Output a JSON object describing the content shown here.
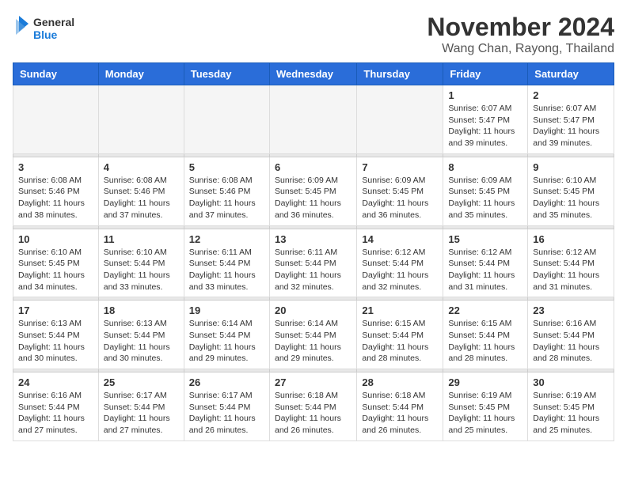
{
  "header": {
    "logo_general": "General",
    "logo_blue": "Blue",
    "month_title": "November 2024",
    "location": "Wang Chan, Rayong, Thailand"
  },
  "days_of_week": [
    "Sunday",
    "Monday",
    "Tuesday",
    "Wednesday",
    "Thursday",
    "Friday",
    "Saturday"
  ],
  "weeks": [
    [
      {
        "day": "",
        "info": ""
      },
      {
        "day": "",
        "info": ""
      },
      {
        "day": "",
        "info": ""
      },
      {
        "day": "",
        "info": ""
      },
      {
        "day": "",
        "info": ""
      },
      {
        "day": "1",
        "info": "Sunrise: 6:07 AM\nSunset: 5:47 PM\nDaylight: 11 hours and 39 minutes."
      },
      {
        "day": "2",
        "info": "Sunrise: 6:07 AM\nSunset: 5:47 PM\nDaylight: 11 hours and 39 minutes."
      }
    ],
    [
      {
        "day": "3",
        "info": "Sunrise: 6:08 AM\nSunset: 5:46 PM\nDaylight: 11 hours and 38 minutes."
      },
      {
        "day": "4",
        "info": "Sunrise: 6:08 AM\nSunset: 5:46 PM\nDaylight: 11 hours and 37 minutes."
      },
      {
        "day": "5",
        "info": "Sunrise: 6:08 AM\nSunset: 5:46 PM\nDaylight: 11 hours and 37 minutes."
      },
      {
        "day": "6",
        "info": "Sunrise: 6:09 AM\nSunset: 5:45 PM\nDaylight: 11 hours and 36 minutes."
      },
      {
        "day": "7",
        "info": "Sunrise: 6:09 AM\nSunset: 5:45 PM\nDaylight: 11 hours and 36 minutes."
      },
      {
        "day": "8",
        "info": "Sunrise: 6:09 AM\nSunset: 5:45 PM\nDaylight: 11 hours and 35 minutes."
      },
      {
        "day": "9",
        "info": "Sunrise: 6:10 AM\nSunset: 5:45 PM\nDaylight: 11 hours and 35 minutes."
      }
    ],
    [
      {
        "day": "10",
        "info": "Sunrise: 6:10 AM\nSunset: 5:45 PM\nDaylight: 11 hours and 34 minutes."
      },
      {
        "day": "11",
        "info": "Sunrise: 6:10 AM\nSunset: 5:44 PM\nDaylight: 11 hours and 33 minutes."
      },
      {
        "day": "12",
        "info": "Sunrise: 6:11 AM\nSunset: 5:44 PM\nDaylight: 11 hours and 33 minutes."
      },
      {
        "day": "13",
        "info": "Sunrise: 6:11 AM\nSunset: 5:44 PM\nDaylight: 11 hours and 32 minutes."
      },
      {
        "day": "14",
        "info": "Sunrise: 6:12 AM\nSunset: 5:44 PM\nDaylight: 11 hours and 32 minutes."
      },
      {
        "day": "15",
        "info": "Sunrise: 6:12 AM\nSunset: 5:44 PM\nDaylight: 11 hours and 31 minutes."
      },
      {
        "day": "16",
        "info": "Sunrise: 6:12 AM\nSunset: 5:44 PM\nDaylight: 11 hours and 31 minutes."
      }
    ],
    [
      {
        "day": "17",
        "info": "Sunrise: 6:13 AM\nSunset: 5:44 PM\nDaylight: 11 hours and 30 minutes."
      },
      {
        "day": "18",
        "info": "Sunrise: 6:13 AM\nSunset: 5:44 PM\nDaylight: 11 hours and 30 minutes."
      },
      {
        "day": "19",
        "info": "Sunrise: 6:14 AM\nSunset: 5:44 PM\nDaylight: 11 hours and 29 minutes."
      },
      {
        "day": "20",
        "info": "Sunrise: 6:14 AM\nSunset: 5:44 PM\nDaylight: 11 hours and 29 minutes."
      },
      {
        "day": "21",
        "info": "Sunrise: 6:15 AM\nSunset: 5:44 PM\nDaylight: 11 hours and 28 minutes."
      },
      {
        "day": "22",
        "info": "Sunrise: 6:15 AM\nSunset: 5:44 PM\nDaylight: 11 hours and 28 minutes."
      },
      {
        "day": "23",
        "info": "Sunrise: 6:16 AM\nSunset: 5:44 PM\nDaylight: 11 hours and 28 minutes."
      }
    ],
    [
      {
        "day": "24",
        "info": "Sunrise: 6:16 AM\nSunset: 5:44 PM\nDaylight: 11 hours and 27 minutes."
      },
      {
        "day": "25",
        "info": "Sunrise: 6:17 AM\nSunset: 5:44 PM\nDaylight: 11 hours and 27 minutes."
      },
      {
        "day": "26",
        "info": "Sunrise: 6:17 AM\nSunset: 5:44 PM\nDaylight: 11 hours and 26 minutes."
      },
      {
        "day": "27",
        "info": "Sunrise: 6:18 AM\nSunset: 5:44 PM\nDaylight: 11 hours and 26 minutes."
      },
      {
        "day": "28",
        "info": "Sunrise: 6:18 AM\nSunset: 5:44 PM\nDaylight: 11 hours and 26 minutes."
      },
      {
        "day": "29",
        "info": "Sunrise: 6:19 AM\nSunset: 5:45 PM\nDaylight: 11 hours and 25 minutes."
      },
      {
        "day": "30",
        "info": "Sunrise: 6:19 AM\nSunset: 5:45 PM\nDaylight: 11 hours and 25 minutes."
      }
    ]
  ]
}
